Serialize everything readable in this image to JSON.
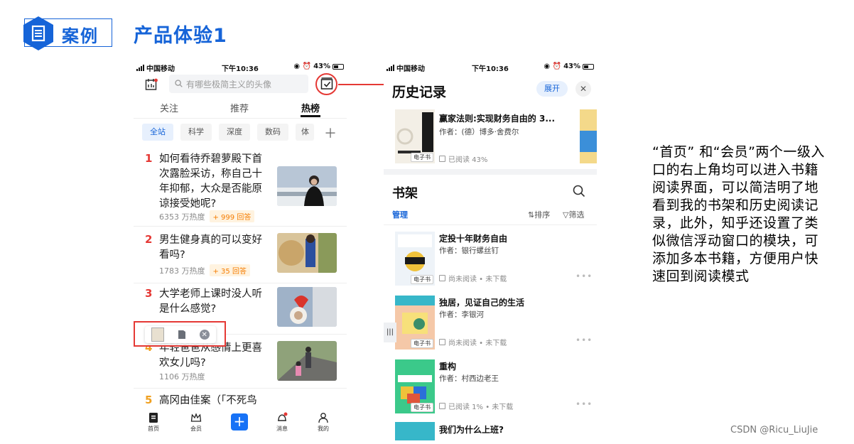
{
  "header": {
    "case_label": "案例",
    "title": "产品体验1"
  },
  "phone1": {
    "status": {
      "carrier": "中国移动",
      "time": "下午10:36",
      "battery": "43%"
    },
    "search_placeholder": "有哪些极简主义的头像",
    "tabs": [
      "关注",
      "推荐",
      "热榜"
    ],
    "active_tab": "热榜",
    "chips": [
      "全站",
      "科学",
      "深度",
      "数码",
      "体育"
    ],
    "hot_list": [
      {
        "rank": "1",
        "title": "如何看待乔碧萝殿下首次露脸采访，称自己十年抑郁，大众是否能原谅接受她呢?",
        "heat": "6353 万热度",
        "answers": "+ 999 回答"
      },
      {
        "rank": "2",
        "title": "男生健身真的可以变好看吗?",
        "heat": "1783 万热度",
        "answers": "+ 35 回答"
      },
      {
        "rank": "3",
        "title": "大学老师上课时没人听是什么感觉?",
        "heat": "",
        "answers": ""
      },
      {
        "rank": "4",
        "title": "年轻爸爸从感情上更喜欢女儿吗?",
        "heat": "1106 万热度",
        "answers": ""
      },
      {
        "rank": "5",
        "title": "高冈由佳案（「不死鸟",
        "heat": "",
        "answers": ""
      }
    ],
    "nav": [
      "首页",
      "会员",
      "消息",
      "我的"
    ]
  },
  "phone2": {
    "status": {
      "carrier": "中国移动",
      "time": "下午10:36",
      "battery": "43%"
    },
    "history_title": "历史记录",
    "expand_label": "展开",
    "history_book": {
      "title": "赢家法则:实现财务自由的 3...",
      "author": "作者：(德）博多·舍费尔",
      "status": "已阅读 43%",
      "tag": "电子书"
    },
    "shelf_title": "书架",
    "manage_label": "管理",
    "sort_label": "排序",
    "filter_label": "筛选",
    "books": [
      {
        "title": "定投十年财务自由",
        "author": "作者：银行螺丝钉",
        "status": "尚未阅读 • 未下载",
        "tag": "电子书"
      },
      {
        "title": "独居，见证自己的生活",
        "author": "作者：李银河",
        "status": "尚未阅读 • 未下载",
        "tag": "电子书"
      },
      {
        "title": "重构",
        "author": "作者：村西边老王",
        "status": "已阅读 1% • 未下载",
        "tag": "电子书"
      },
      {
        "title": "我们为什么上班?",
        "author": "",
        "status": "",
        "tag": ""
      }
    ]
  },
  "description": "“首页” 和“会员”两个一级入口的右上角均可以进入书籍阅读界面，可以简洁明了地看到我的书架和历史阅读记录，此外，知乎还设置了类似微信浮动窗口的模块，可添加多本书籍，方便用户快速回到阅读模式",
  "watermark": "CSDN @Ricu_LiuJie",
  "colors": {
    "brand_blue": "#1664d8",
    "highlight_red": "#e53935",
    "rank_red": "#e53935",
    "rank_orange": "#f0a020"
  }
}
